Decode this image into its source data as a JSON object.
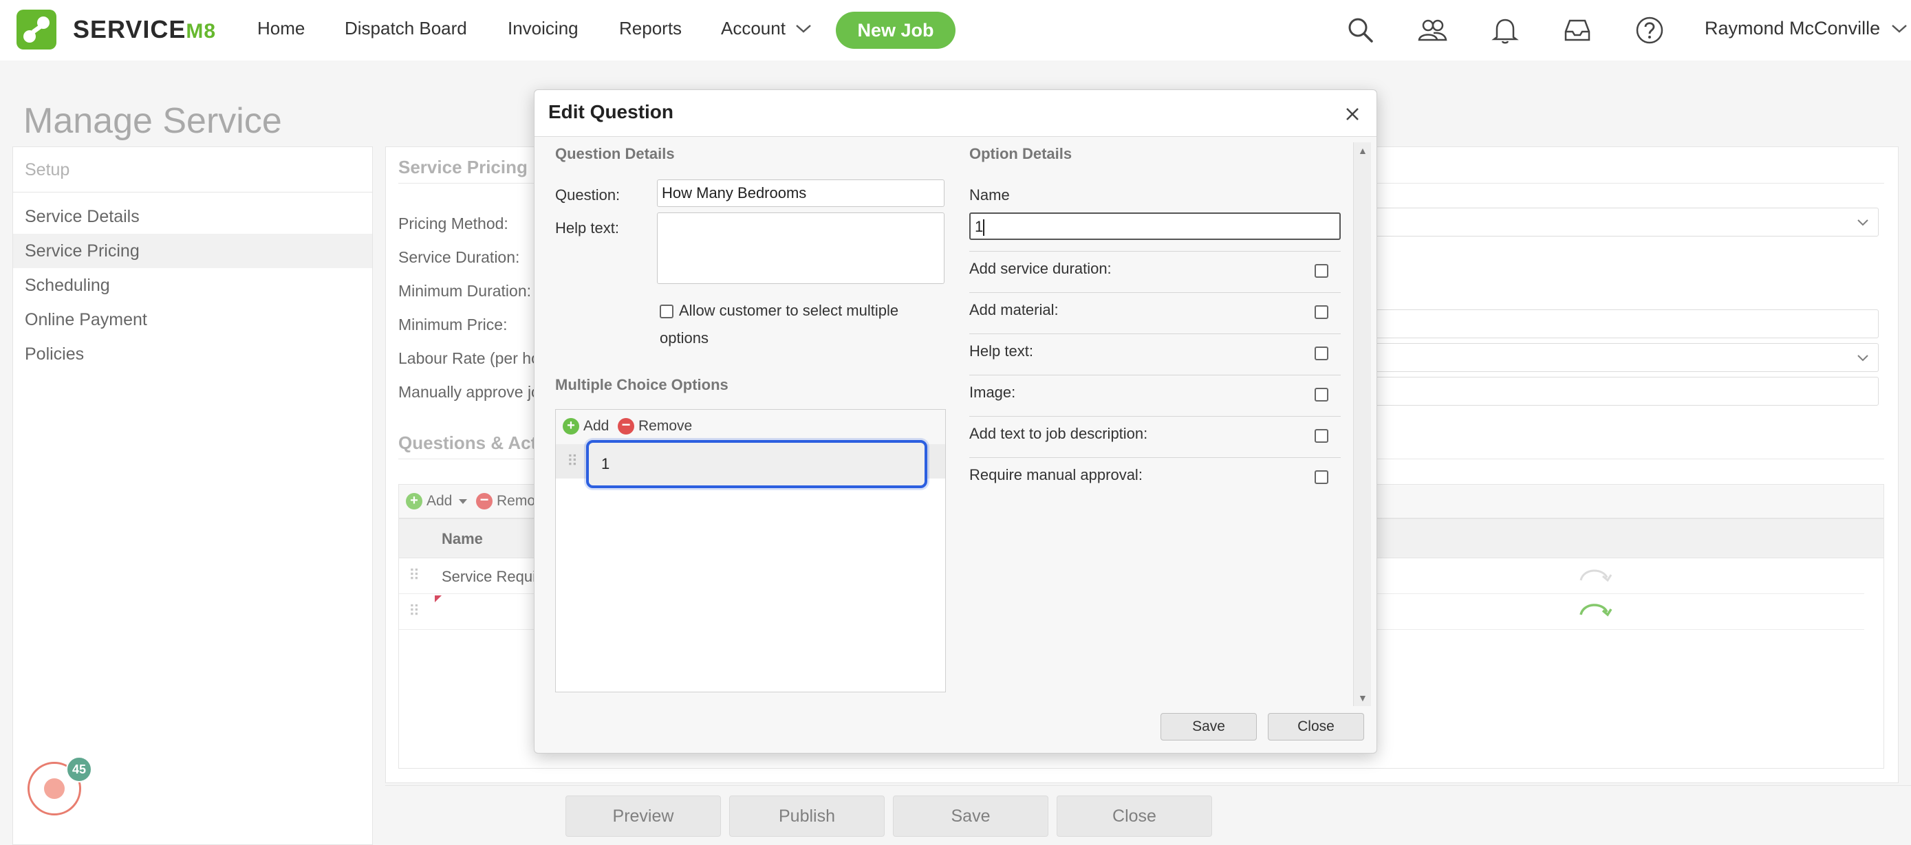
{
  "nav": {
    "brand": "SERVICE",
    "brand_suffix": "M8",
    "items": [
      "Home",
      "Dispatch Board",
      "Invoicing",
      "Reports"
    ],
    "account_label": "Account",
    "new_job_label": "New Job",
    "user_name": "Raymond McConville"
  },
  "page": {
    "title": "Manage Service"
  },
  "sidebar": {
    "header": "Setup",
    "items": [
      {
        "label": "Service Details",
        "active": false
      },
      {
        "label": "Service Pricing",
        "active": true
      },
      {
        "label": "Scheduling",
        "active": false
      },
      {
        "label": "Online Payment",
        "active": false
      },
      {
        "label": "Policies",
        "active": false
      }
    ]
  },
  "pricing": {
    "section_title": "Service Pricing",
    "fields": [
      "Pricing Method:",
      "Service Duration:",
      "Minimum Duration:",
      "Minimum Price:",
      "Labour Rate (per hou",
      "Manually approve jo"
    ],
    "qa_title": "Questions & Acti",
    "qa_add": "Add",
    "qa_remove": "Remo",
    "qa_name_header": "Name",
    "qa_rows": [
      "Service Requi",
      ""
    ]
  },
  "bottom_buttons": {
    "preview": "Preview",
    "publish": "Publish",
    "save": "Save",
    "close": "Close"
  },
  "notifications": {
    "badge_count": "45"
  },
  "modal": {
    "title": "Edit Question",
    "question_details_title": "Question Details",
    "question_label": "Question:",
    "question_value": "How Many Bedrooms",
    "help_text_label": "Help text:",
    "help_text_value": "",
    "allow_multiple_label_1": "Allow customer to select multiple",
    "allow_multiple_label_2": "options",
    "allow_multiple_checked": false,
    "mc_title": "Multiple Choice Options",
    "mc_add": "Add",
    "mc_remove": "Remove",
    "mc_options": [
      "1"
    ],
    "option_details_title": "Option Details",
    "name_label": "Name",
    "name_value": "1",
    "option_fields": [
      {
        "label": "Add service duration:",
        "checked": false
      },
      {
        "label": "Add material:",
        "checked": false
      },
      {
        "label": "Help text:",
        "checked": false
      },
      {
        "label": "Image:",
        "checked": false
      },
      {
        "label": "Add text to job description:",
        "checked": false
      },
      {
        "label": "Require manual approval:",
        "checked": false
      }
    ],
    "save_label": "Save",
    "close_label": "Close"
  },
  "colors": {
    "brand_green": "#6cc04a",
    "focus_blue": "#2c5fe0",
    "badge_green": "#2a8a6a",
    "alert_red": "#e0523f"
  }
}
